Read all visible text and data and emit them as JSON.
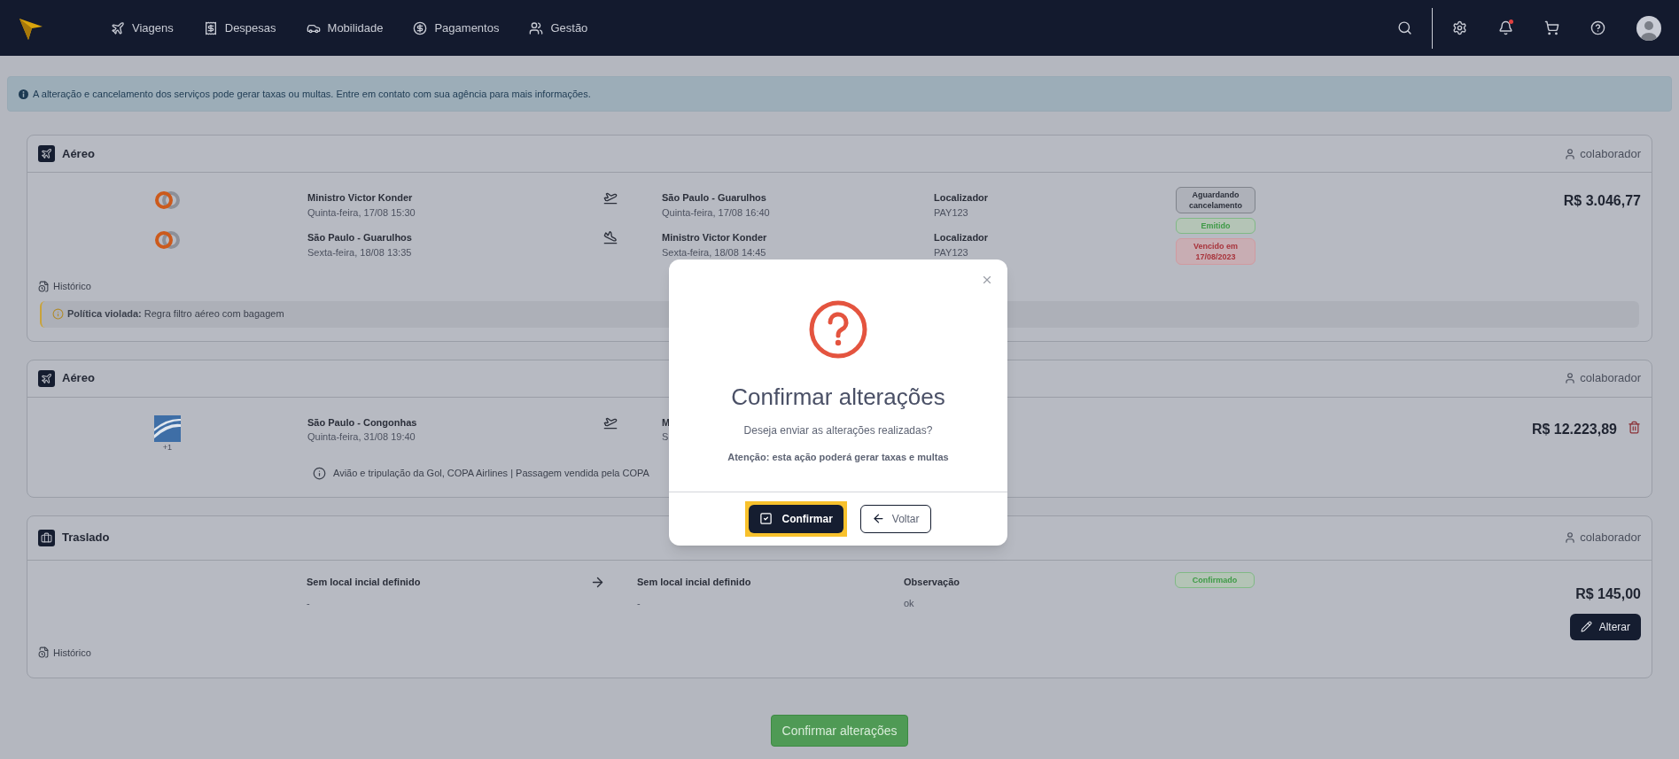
{
  "nav": {
    "items": [
      {
        "kind": "plane",
        "label": "Viagens"
      },
      {
        "kind": "receipt",
        "label": "Despesas"
      },
      {
        "kind": "car",
        "label": "Mobilidade"
      },
      {
        "kind": "money",
        "label": "Pagamentos"
      },
      {
        "kind": "people",
        "label": "Gestão"
      }
    ]
  },
  "alert": "A alteração e cancelamento dos serviços pode gerar taxas ou multas. Entre em contato com sua agência para mais informações.",
  "cards": [
    {
      "kind": "air",
      "title": "Aéreo",
      "traveler": "colaborador",
      "segments": [
        {
          "logo": {
            "kind": "rings"
          },
          "origin": "Ministro Victor Konder",
          "origin_date": "Quinta-feira, 17/08 15:30",
          "direction": {
            "kind": "takeoff"
          },
          "destination": "São Paulo - Guarulhos",
          "destination_date": "Quinta-feira, 17/08 16:40",
          "locator_label": "Localizador",
          "locator": "PAY123"
        },
        {
          "logo": {
            "kind": "rings"
          },
          "origin": "São Paulo - Guarulhos",
          "origin_date": "Sexta-feira, 18/08 13:35",
          "direction": {
            "kind": "landing"
          },
          "destination": "Ministro Victor Konder",
          "destination_date": "Sexta-feira, 18/08 14:45",
          "locator_label": "Localizador",
          "locator": "PAY123"
        }
      ],
      "statuses": [
        {
          "kind": "neutral",
          "label": "Aguardando cancelamento"
        },
        {
          "kind": "success",
          "label": "Emitido"
        },
        {
          "kind": "danger",
          "label": "Vencido em 17/08/2023"
        }
      ],
      "price": "R$ 3.046,77",
      "history": "Histórico",
      "policy": {
        "label": "Política violada:",
        "text": "Regra filtro aéreo com bagagem"
      }
    },
    {
      "kind": "air",
      "title": "Aéreo",
      "traveler": "colaborador",
      "segments": [
        {
          "logo": {
            "kind": "stripes"
          },
          "count": "+1",
          "origin": "São Paulo - Congonhas",
          "origin_date": "Quinta-feira, 31/08 19:40",
          "direction": {
            "kind": "takeoff"
          },
          "destination": "M",
          "destination_date": "S"
        }
      ],
      "note": "Avião e tripulação da Gol, COPA Airlines | Passagem vendida pela COPA",
      "price": "R$ 12.223,89",
      "deletable": true
    },
    {
      "kind": "transfer",
      "title": "Traslado",
      "traveler": "colaborador",
      "origin": "Sem local incial definido",
      "origin_detail": "-",
      "destination": "Sem local incial definido",
      "destination_detail": "-",
      "observation_label": "Observação",
      "observation": "ok",
      "statuses": [
        {
          "kind": "success",
          "label": "Confirmado"
        }
      ],
      "price": "R$ 145,00",
      "action": "Alterar",
      "history": "Histórico"
    }
  ],
  "footer_button": "Confirmar alterações",
  "modal": {
    "title": "Confirmar alterações",
    "message": "Deseja enviar as alterações realizadas?",
    "warning": "Atenção: esta ação poderá gerar taxas e multas",
    "confirm": {
      "label": "Confirmar",
      "focused": true
    },
    "back": "Voltar"
  }
}
